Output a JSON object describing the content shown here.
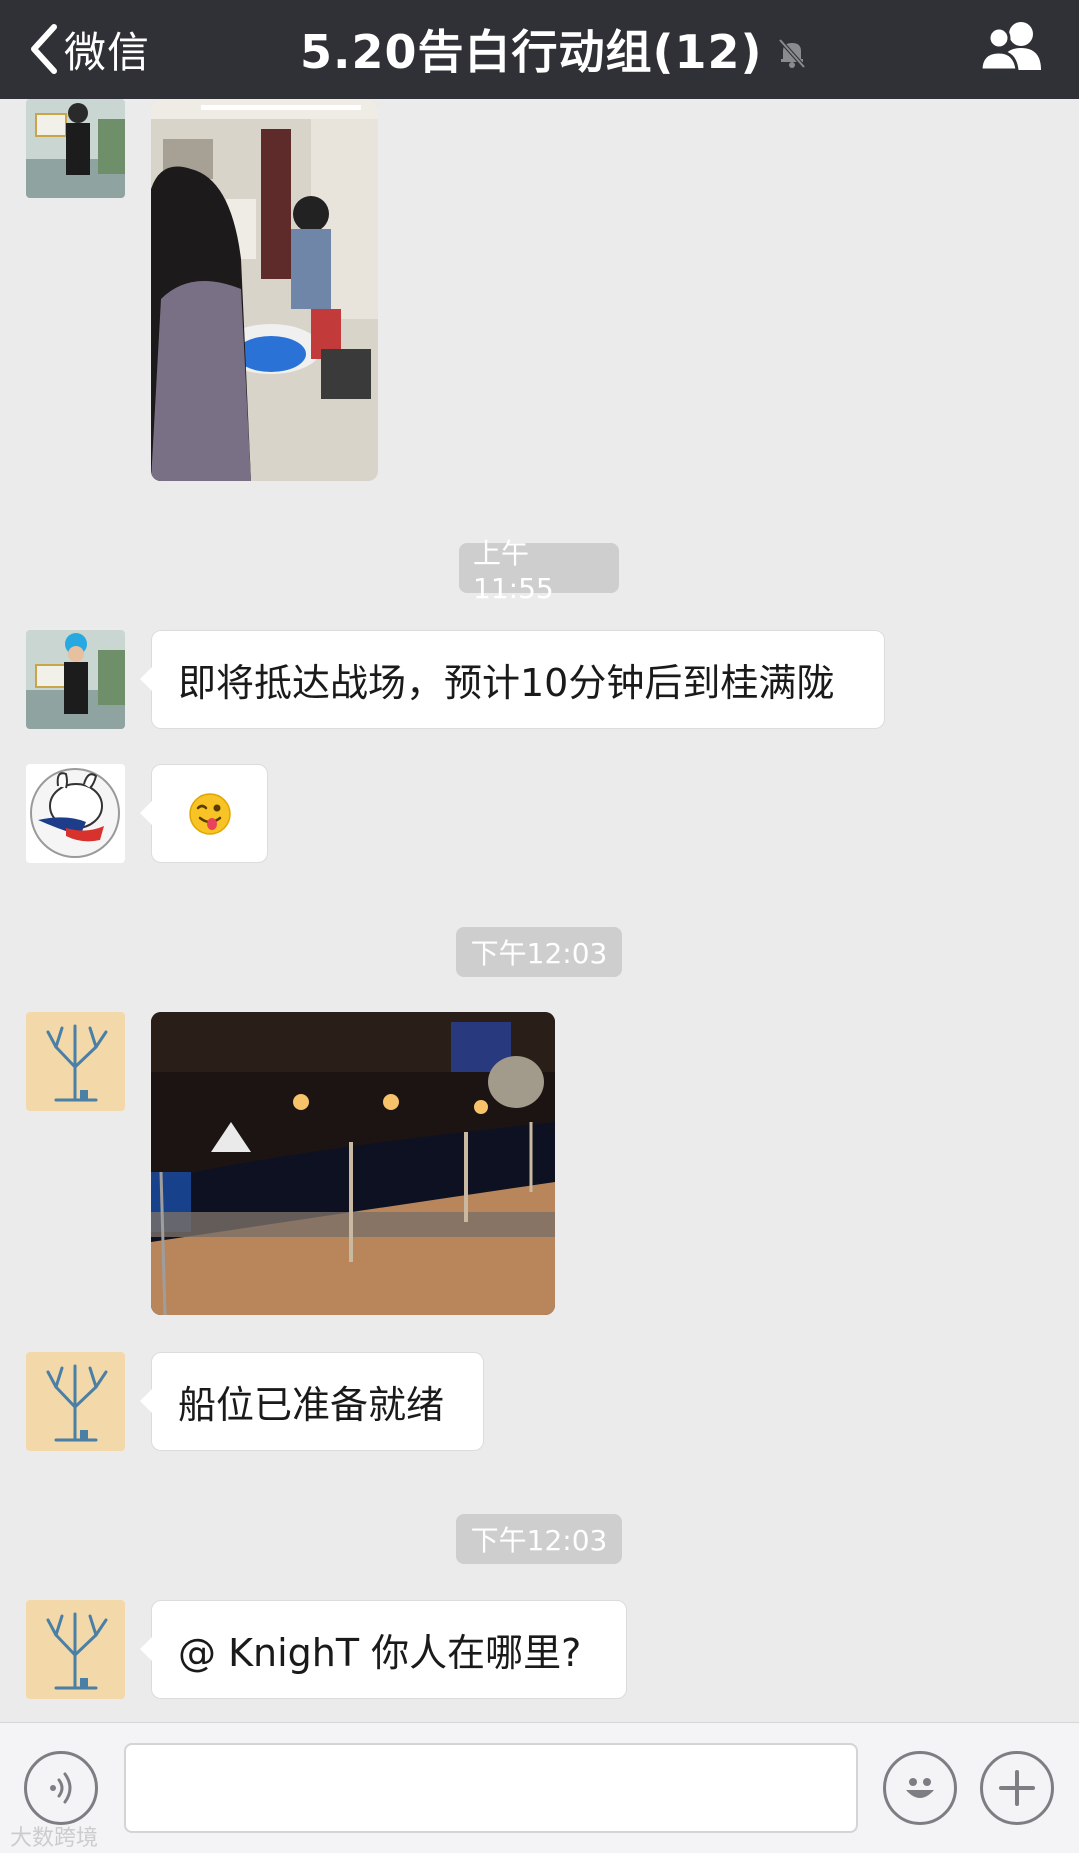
{
  "header": {
    "back_label": "微信",
    "title": "5.20告白行动组(12)"
  },
  "messages": [
    {
      "type": "image",
      "sender_avatar": "avatar-blue-hair"
    },
    {
      "type": "timestamp",
      "text": "上午11:55"
    },
    {
      "type": "text",
      "sender_avatar": "avatar-blue-hair",
      "text": "即将抵达战场，预计10分钟后到桂满陇"
    },
    {
      "type": "emoji",
      "sender_avatar": "avatar-cartoon-rabbit",
      "emoji": "😜"
    },
    {
      "type": "timestamp",
      "text": "下午12:03"
    },
    {
      "type": "image",
      "sender_avatar": "avatar-tree"
    },
    {
      "type": "text",
      "sender_avatar": "avatar-tree",
      "text": "船位已准备就绪"
    },
    {
      "type": "timestamp",
      "text": "下午12:03"
    },
    {
      "type": "text",
      "sender_avatar": "avatar-tree",
      "text": "@ KnighT 你人在哪里?"
    }
  ],
  "inputbar": {
    "placeholder": ""
  },
  "watermark": "大数跨境",
  "colors": {
    "header_bg": "#2f3136",
    "chat_bg": "#ebebeb",
    "bubble_bg": "#ffffff",
    "timestamp_bg": "#cecece"
  }
}
